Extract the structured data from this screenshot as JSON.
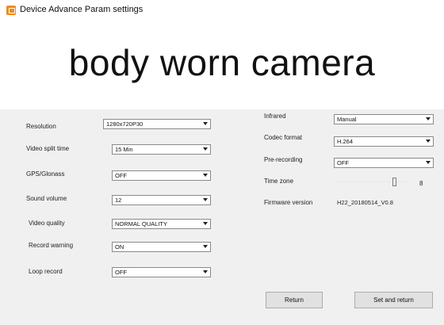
{
  "window": {
    "title": "Device Advance Param settings"
  },
  "banner": {
    "text": "body worn camera"
  },
  "left_fields": {
    "resolution": {
      "label": "Resolution",
      "value": "1280x720P30"
    },
    "video_split_time": {
      "label": "Video split time",
      "value": "15 Min"
    },
    "gps": {
      "label": "GPS/Glonass",
      "value": "OFF"
    },
    "sound_volume": {
      "label": "Sound volume",
      "value": "12"
    },
    "video_quality": {
      "label": "Video quality",
      "value": "NORMAL QUALITY"
    },
    "record_warning": {
      "label": "Record warning",
      "value": "ON"
    },
    "loop_record": {
      "label": "Loop record",
      "value": "OFF"
    }
  },
  "right_fields": {
    "infrared": {
      "label": "Infrared",
      "value": "Manual"
    },
    "codec_format": {
      "label": "Codec format",
      "value": "H.264"
    },
    "pre_recording": {
      "label": "Pre-recording",
      "value": "OFF"
    },
    "time_zone": {
      "label": "Time zone",
      "value": "8",
      "slider_fraction": 0.82
    },
    "firmware": {
      "label": "Firmware version",
      "value": "H22_20180514_V0.8"
    }
  },
  "buttons": {
    "return_label": "Return",
    "set_return_label": "Set and return"
  },
  "icons": {
    "app": "camera-app-icon",
    "dropdown": "chevron-down-icon"
  }
}
